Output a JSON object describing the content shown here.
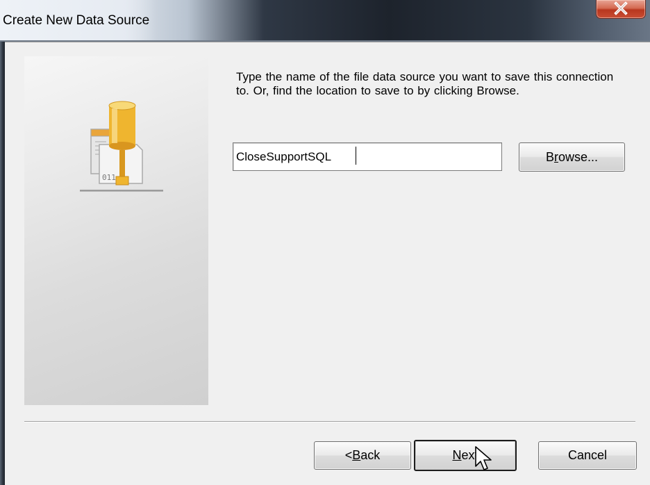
{
  "window": {
    "title": "Create New Data Source",
    "close_glyph": "X"
  },
  "content": {
    "instructions": "Type the name of the file data source you want to save this connection to.  Or, find the location to save to by clicking Browse.",
    "data_source_name": "CloseSupportSQL",
    "graphic_text": "011 0"
  },
  "buttons": {
    "browse": {
      "before": "B",
      "accel": "r",
      "after": "owse..."
    },
    "back": {
      "before": "< ",
      "accel": "B",
      "after": "ack"
    },
    "next": {
      "before": "",
      "accel": "N",
      "after": "ext"
    },
    "cancel": "Cancel"
  },
  "icons": {
    "close": "close-icon",
    "data_source": "file-data-source-icon",
    "cursor": "mouse-pointer-icon"
  }
}
